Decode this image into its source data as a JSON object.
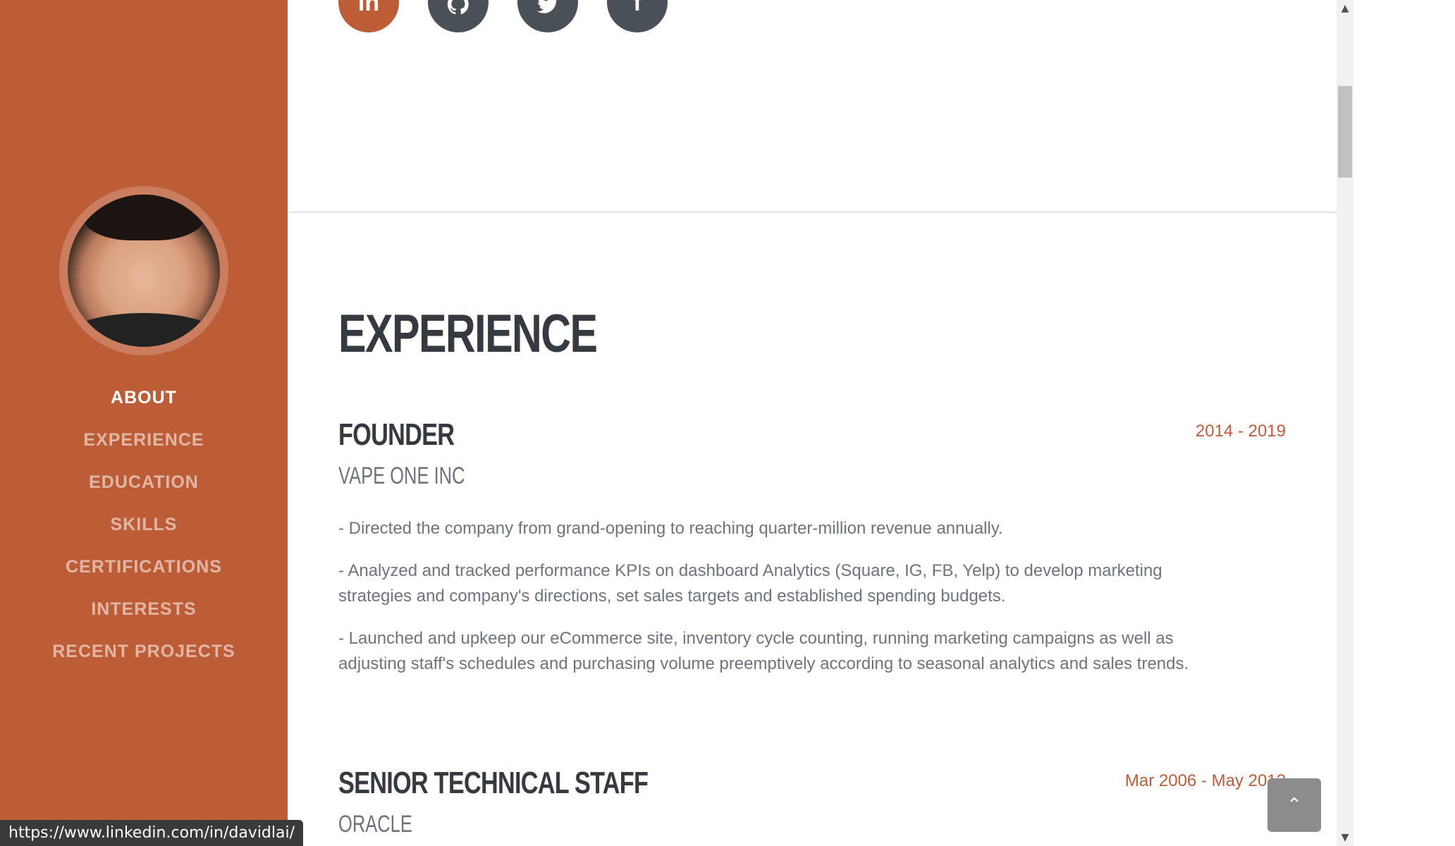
{
  "sidebar": {
    "nav": [
      {
        "label": "ABOUT",
        "active": true
      },
      {
        "label": "EXPERIENCE",
        "active": false
      },
      {
        "label": "EDUCATION",
        "active": false
      },
      {
        "label": "SKILLS",
        "active": false
      },
      {
        "label": "CERTIFICATIONS",
        "active": false
      },
      {
        "label": "INTERESTS",
        "active": false
      },
      {
        "label": "RECENT PROJECTS",
        "active": false
      }
    ]
  },
  "social": {
    "icons": [
      "linkedin-icon",
      "github-icon",
      "twitter-icon",
      "facebook-icon"
    ],
    "linkedin_glyph": "in",
    "facebook_glyph": "f"
  },
  "experience": {
    "section_title": "EXPERIENCE",
    "jobs": [
      {
        "title": "FOUNDER",
        "company": "VAPE ONE INC",
        "date": "2014 - 2019",
        "bullets": [
          "- Directed the company from grand-opening to reaching quarter-million revenue annually.",
          "- Analyzed and tracked performance KPIs on dashboard Analytics (Square, IG, FB, Yelp) to develop marketing strategies and company's directions, set sales targets and established spending budgets.",
          "- Launched and upkeep our eCommerce site, inventory cycle counting, running marketing campaigns as well as adjusting staff's schedules and purchasing volume preemptively according to seasonal analytics and sales trends."
        ]
      },
      {
        "title": "SENIOR TECHNICAL STAFF",
        "company": "ORACLE",
        "date": "Mar 2006 - May 2012"
      }
    ]
  },
  "status_bar": {
    "url": "https://www.linkedin.com/in/davidlai/"
  },
  "colors": {
    "primary": "#BD5D38",
    "dark": "#343a40",
    "muted": "#6c757d",
    "icon_bg": "#495057"
  }
}
